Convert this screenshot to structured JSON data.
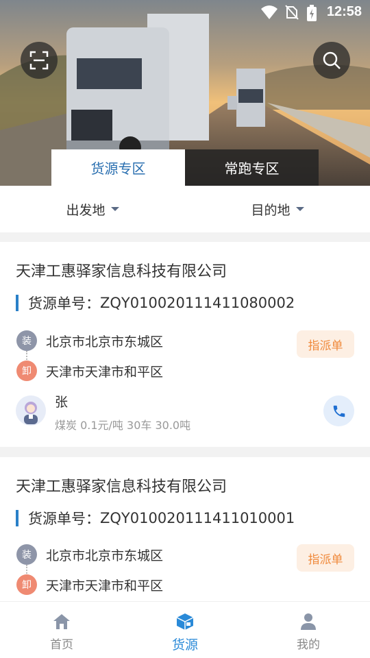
{
  "status_bar": {
    "time": "12:58"
  },
  "hero": {
    "tabs": [
      {
        "label": "货源专区",
        "active": true
      },
      {
        "label": "常跑专区",
        "active": false
      }
    ]
  },
  "filters": {
    "origin": "出发地",
    "destination": "目的地"
  },
  "cards": [
    {
      "company": "天津工惠驿家信息科技有限公司",
      "order_prefix": "货源单号：",
      "order_no": "ZQY010020111411080002",
      "load_tag": "装",
      "load_place": "北京市北京市东城区",
      "unload_tag": "卸",
      "unload_place": "天津市天津市和平区",
      "badge": "指派单",
      "contact": "张",
      "goods": "煤炭 0.1元/吨 30车 30.0吨"
    },
    {
      "company": "天津工惠驿家信息科技有限公司",
      "order_prefix": "货源单号：",
      "order_no": "ZQY010020111411010001",
      "load_tag": "装",
      "load_place": "北京市北京市东城区",
      "unload_tag": "卸",
      "unload_place": "天津市天津市和平区",
      "badge": "指派单"
    }
  ],
  "bottom_nav": [
    {
      "label": "首页",
      "icon": "home-icon",
      "active": false
    },
    {
      "label": "货源",
      "icon": "cargo-box-icon",
      "active": true
    },
    {
      "label": "我的",
      "icon": "profile-icon",
      "active": false
    }
  ],
  "colors": {
    "accent": "#2a8ad8",
    "assign_text": "#f08a3c",
    "assign_bg": "#fdefe3",
    "load_dot": "#8e95a8",
    "unload_dot": "#ef8a72"
  }
}
